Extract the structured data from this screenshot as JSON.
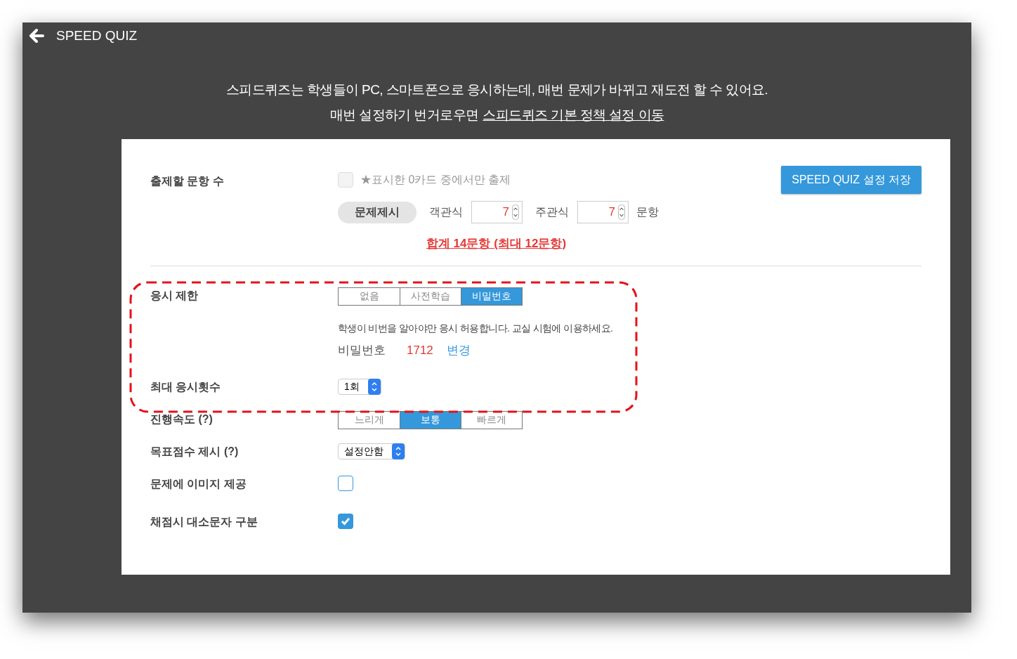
{
  "header": {
    "title": "SPEED QUIZ"
  },
  "intro": {
    "line1": "스피드퀴즈는 학생들이 PC, 스마트폰으로 응시하는데, 매번 문제가 바뀌고 재도전 할 수 있어요.",
    "line2": "매번 설정하기 번거로우면",
    "link": "스피드퀴즈 기본 정책 설정 이동"
  },
  "save_button": "SPEED QUIZ 설정 저장",
  "question_count": {
    "label": "출제할 문항 수",
    "starred_only": {
      "label": "★표시한 0카드 중에서만 출제",
      "checked": false,
      "disabled": true
    },
    "present_button": "문제제시",
    "objective": {
      "label": "객관식",
      "value": "7"
    },
    "subjective": {
      "label": "주관식",
      "value": "7"
    },
    "unit": "문항",
    "warning": "합계 14문항 (최대 12문항)"
  },
  "settings": [
    {
      "kind": "segmented",
      "label": "응시 제한",
      "options": [
        {
          "label": "없음",
          "selected": false
        },
        {
          "label": "사전학습",
          "selected": false
        },
        {
          "label": "비밀번호",
          "selected": true
        }
      ],
      "description": "학생이 비번을 알아야만 응시 허용합니다. 교실 시험에 이용하세요.",
      "password": {
        "label": "비밀번호",
        "value": "1712",
        "change": "변경"
      }
    },
    {
      "kind": "select",
      "label": "최대 응시횟수",
      "value": "1회"
    },
    {
      "kind": "segmented",
      "label": "진행속도 (?)",
      "options": [
        {
          "label": "느리게",
          "selected": false
        },
        {
          "label": "보통",
          "selected": true
        },
        {
          "label": "빠르게",
          "selected": false
        }
      ]
    },
    {
      "kind": "select",
      "label": "목표점수 제시 (?)",
      "value": "설정안함"
    },
    {
      "kind": "checkbox",
      "label": "문제에 이미지 제공",
      "checked": false
    },
    {
      "kind": "checkbox",
      "label": "채점시 대소문자 구분",
      "checked": true
    }
  ]
}
